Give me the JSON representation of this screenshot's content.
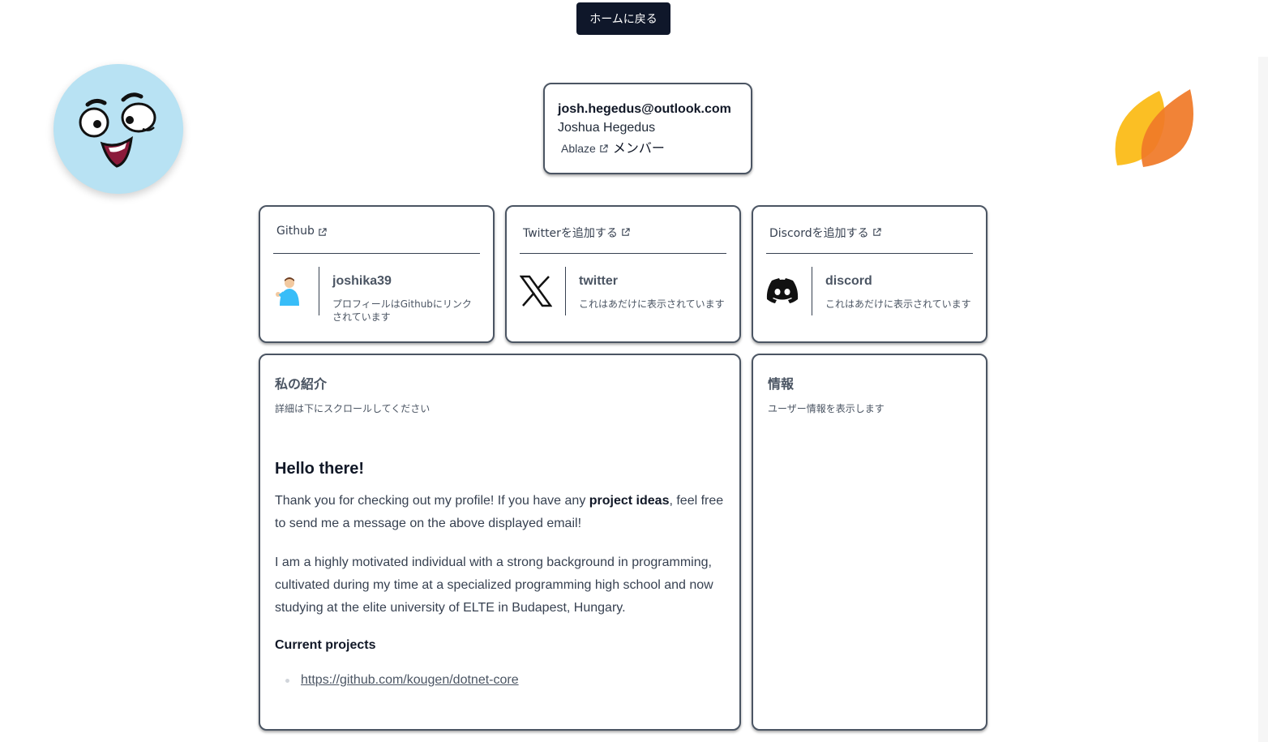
{
  "home_button": {
    "label": "ホームに戻る"
  },
  "profile": {
    "email": "josh.hegedus@outlook.com",
    "name": "Joshua Hegedus",
    "org": "Ablaze",
    "org_role": "メンバー"
  },
  "social": {
    "github": {
      "header": "Github",
      "title": "joshika39",
      "desc": "プロフィールはGithubにリンクされています"
    },
    "twitter": {
      "header": "Twitterを追加する",
      "title": "twitter",
      "desc": "これはあだけに表示されています"
    },
    "discord": {
      "header": "Discordを追加する",
      "title": "discord",
      "desc": "これはあだけに表示されています"
    }
  },
  "about": {
    "title": "私の紹介",
    "subtitle": "詳細は下にスクロールしてください",
    "heading": "Hello there!",
    "p1_before": "Thank you for checking out my profile! If you have any ",
    "p1_bold": "project ideas",
    "p1_after": ", feel free to send me a message on the above displayed email!",
    "p2": "I am a highly motivated individual with a strong background in programming, cultivated during my time at a specialized programming high school and now studying at the elite university of ELTE in Budapest, Hungary.",
    "projects_heading": "Current projects",
    "projects": [
      "https://github.com/kougen/dotnet-core"
    ]
  },
  "info": {
    "title": "情報",
    "subtitle": "ユーザー情報を表示します"
  },
  "icons": {
    "face": "cartoon-face-avatar",
    "leaf": "orange-leaf-logo",
    "external": "external-link-icon",
    "x": "x-logo-icon",
    "discord": "discord-logo-icon",
    "github_avatar": "github-avatar-icon"
  },
  "colors": {
    "button_bg": "#0f172a",
    "face_bg": "#b8e2f3",
    "leaf_light": "#fbbf24",
    "leaf_dark": "#f97316",
    "card_border": "#4b5563"
  }
}
